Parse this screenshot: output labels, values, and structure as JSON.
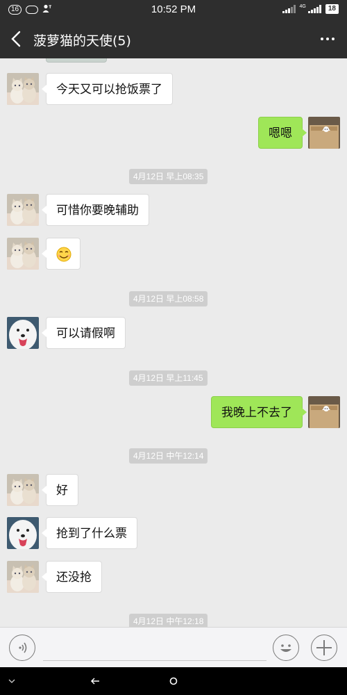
{
  "status_bar": {
    "notification_count": "16",
    "time": "10:52 PM",
    "network_label": "4G",
    "battery": "18"
  },
  "nav": {
    "title": "菠萝猫的天使(5)"
  },
  "contacts": {
    "cat_avatar": "two-cats-avatar",
    "dog_avatar": "samoyed-dog-avatar",
    "self_avatar": "cat-in-box-avatar"
  },
  "messages": [
    {
      "type": "in",
      "avatar": "cat",
      "text": "今天又可以抢饭票了"
    },
    {
      "type": "out",
      "text": "嗯嗯"
    },
    {
      "type": "time",
      "text": "4月12日 早上08:35"
    },
    {
      "type": "in",
      "avatar": "cat",
      "text": "可惜你要晚辅助"
    },
    {
      "type": "in",
      "avatar": "cat",
      "emoji": "smile-emoji"
    },
    {
      "type": "time",
      "text": "4月12日 早上08:58"
    },
    {
      "type": "in",
      "avatar": "dog",
      "text": "可以请假啊"
    },
    {
      "type": "time",
      "text": "4月12日 早上11:45"
    },
    {
      "type": "out",
      "text": "我晚上不去了"
    },
    {
      "type": "time",
      "text": "4月12日 中午12:14"
    },
    {
      "type": "in",
      "avatar": "cat",
      "text": "好"
    },
    {
      "type": "in",
      "avatar": "dog",
      "text": "抢到了什么票"
    },
    {
      "type": "in",
      "avatar": "cat",
      "text": "还没抢"
    },
    {
      "type": "time",
      "text": "4月12日 中午12:18"
    }
  ],
  "input_bar": {
    "text_value": ""
  },
  "colors": {
    "header_bg": "#2e2e2e",
    "chat_bg": "#ebebeb",
    "out_bubble": "#9fe658",
    "in_bubble": "#ffffff",
    "timestamp_bg": "#cecece"
  }
}
